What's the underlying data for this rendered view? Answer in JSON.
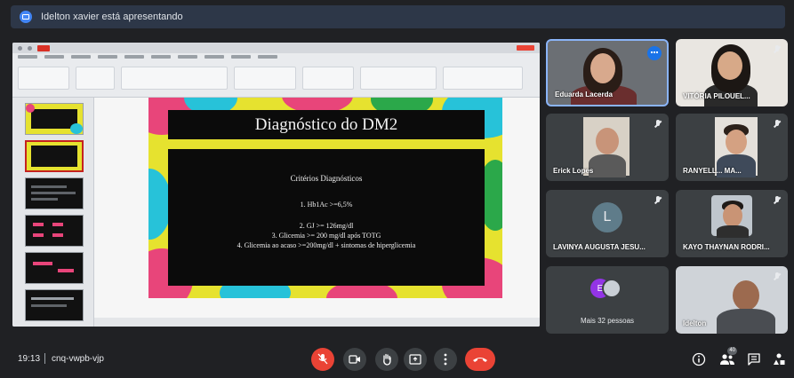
{
  "presenting": {
    "text": "Idelton xavier está apresentando"
  },
  "slide": {
    "title": "Diagnóstico do DM2",
    "subtitle": "Critérios Diagnósticos",
    "line1": "1.   Hb1Ac >=6,5%",
    "line2": "2. GJ >= 126mg/dl",
    "line3": "3. Glicemia >= 200 mg/dl após TOTG",
    "line4": "4. Glicemia ao acaso >=200mg/dl + sintomas de hiperglicemia"
  },
  "participants": [
    {
      "name": "Eduarda Lacerda",
      "speaking": true
    },
    {
      "name": "VITÓRIA PILOUEL...",
      "muted": true
    },
    {
      "name": "Erick Lopes",
      "muted": true
    },
    {
      "name": "RANYELL... MA...",
      "muted": true
    },
    {
      "name": "LAVINYA AUGUSTA JESU...",
      "initial": "L",
      "muted": true
    },
    {
      "name": "KAYO THAYNAN RODRI...",
      "muted": true
    },
    {
      "name": "Mais 32 pessoas",
      "initial": "E"
    },
    {
      "name": "Idelton",
      "muted": true
    }
  ],
  "bottom": {
    "time": "19:13",
    "meeting_code": "cnq-vwpb-vjp",
    "participant_count_badge": "40"
  },
  "icons": {
    "mic_off": "mic-off-icon",
    "camera": "camera-icon",
    "hand": "raise-hand-icon",
    "present": "present-screen-icon",
    "more": "more-options-icon",
    "hangup": "hang-up-icon",
    "info": "info-icon",
    "people": "people-icon",
    "chat": "chat-icon",
    "activities": "activities-icon"
  },
  "colors": {
    "accent": "#1a73e8",
    "danger": "#ea4335",
    "background": "#202124"
  }
}
